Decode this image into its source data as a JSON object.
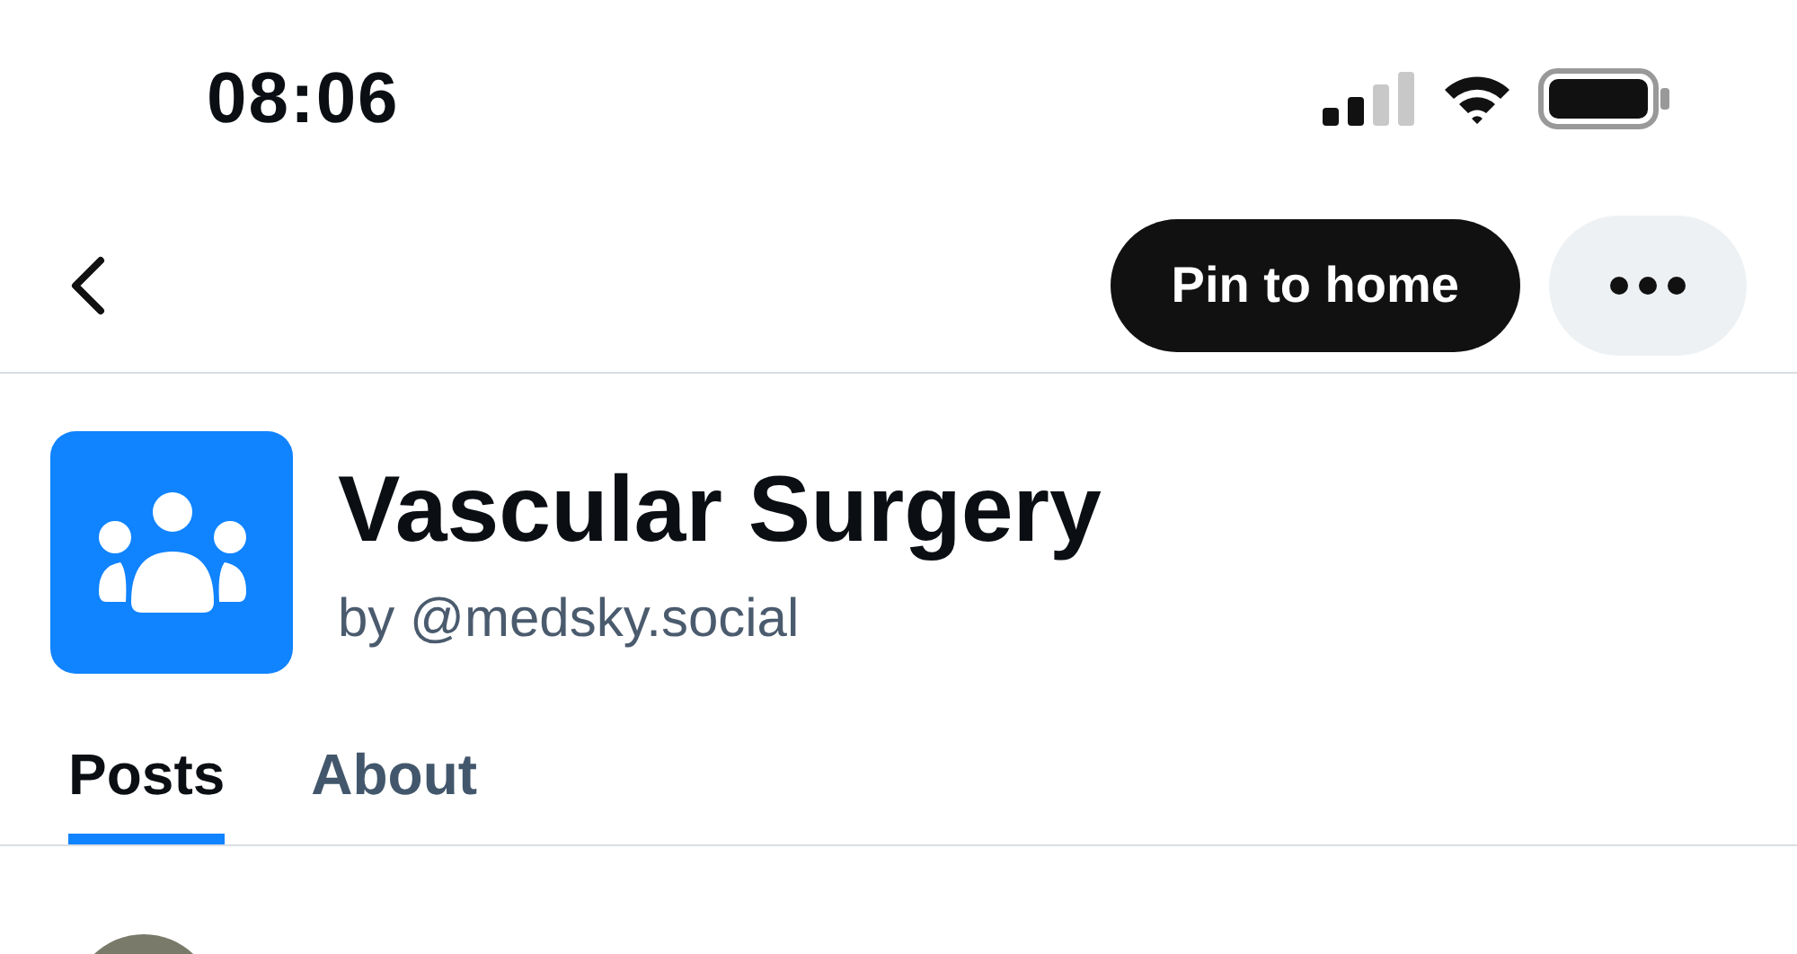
{
  "status_bar": {
    "time": "08:06"
  },
  "nav": {
    "pin_button": "Pin to home"
  },
  "feed": {
    "title": "Vascular Surgery",
    "byline": "by @medsky.social"
  },
  "tabs": [
    {
      "label": "Posts",
      "selected": true
    },
    {
      "label": "About",
      "selected": false
    }
  ]
}
